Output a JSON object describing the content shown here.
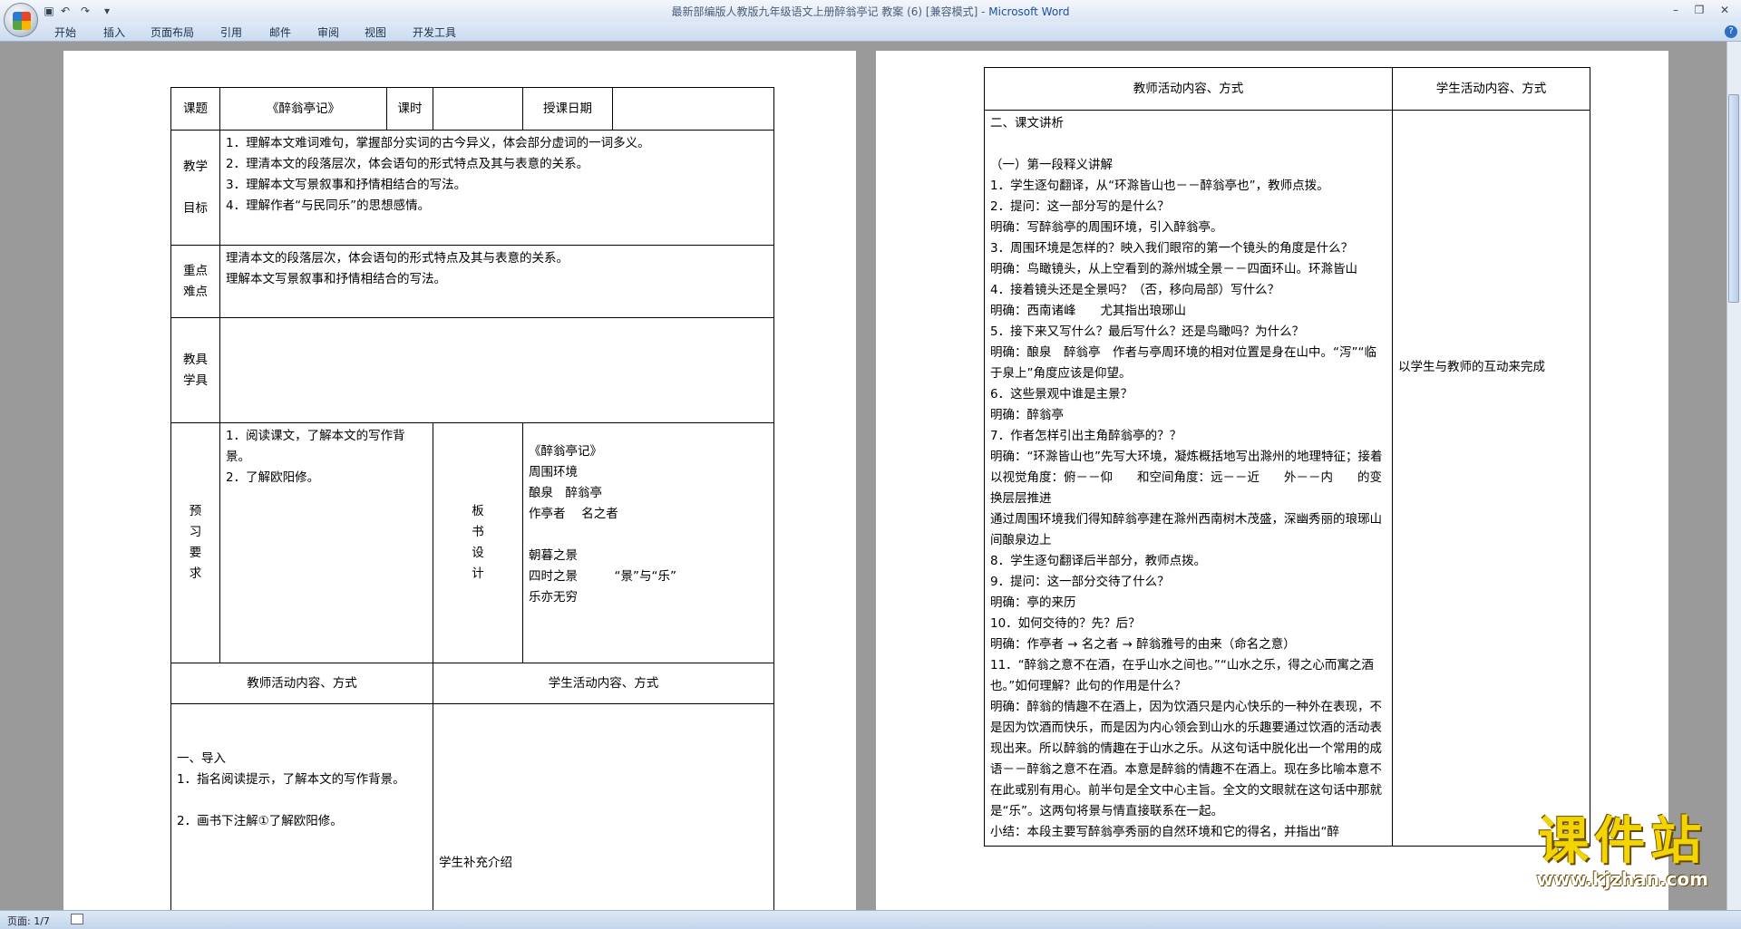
{
  "window": {
    "title": "最新部编版人教版九年级语文上册醉翁亭记 教案 (6) [兼容模式] - ",
    "app": "Microsoft Word"
  },
  "ribbon": {
    "tabs": [
      "开始",
      "插入",
      "页面布局",
      "引用",
      "邮件",
      "审阅",
      "视图",
      "开发工具"
    ]
  },
  "status": {
    "page": "页面: 1/7"
  },
  "watermark": {
    "text": "课件站",
    "url": "www.kjzhan.com"
  },
  "page1": {
    "lesson_label": "课题",
    "lesson_title": "《醉翁亭记》",
    "hours_label": "课时",
    "date_label": "授课日期",
    "goals_label": [
      "教学",
      "目标"
    ],
    "goals": [
      "1．理解本文难词难句，掌握部分实词的古今异义，体会部分虚词的一词多义。",
      "2．理清本文的段落层次，体会语句的形式特点及其与表意的关系。",
      "3．理解本文写景叙事和抒情相结合的写法。",
      "4．理解作者“与民同乐”的思想感情。"
    ],
    "key_label": [
      "重点",
      "难点"
    ],
    "key_points": [
      "理清本文的段落层次，体会语句的形式特点及其与表意的关系。",
      "理解本文写景叙事和抒情相结合的写法。"
    ],
    "tools_label": [
      "教具",
      "学具"
    ],
    "preview_label": [
      "预",
      "习",
      "要",
      "求"
    ],
    "preview": [
      "1．阅读课文，了解本文的写作背景。",
      "2．了解欧阳修。"
    ],
    "board_label": [
      "板",
      "书",
      "设",
      "计"
    ],
    "board": [
      "《醉翁亭记》",
      "周围环境",
      "酿泉　醉翁亭",
      "作亭者　 名之者",
      "",
      "朝暮之景",
      "四时之景　　　“景”与“乐”",
      "乐亦无穷"
    ],
    "teacher_head": "教师活动内容、方式",
    "student_head": "学生活动内容、方式",
    "teacher_items": [
      "",
      "一、导入",
      "1．指名阅读提示，了解本文的写作背景。",
      "",
      "2．画书下注解①了解欧阳修。"
    ],
    "student_note": "学生补充介绍"
  },
  "page2": {
    "teacher_head": "教师活动内容、方式",
    "student_head": "学生活动内容、方式",
    "student_note": "以学生与教师的互动来完成",
    "lines": [
      "二、课文讲析",
      "",
      "（一）第一段释义讲解",
      "1．学生逐句翻译，从“环滁皆山也－－醉翁亭也”，教师点拨。",
      "2．提问：这一部分写的是什么？",
      "明确：写醉翁亭的周围环境，引入醉翁亭。",
      "3．周围环境是怎样的？映入我们眼帘的第一个镜头的角度是什么？",
      "明确：鸟瞰镜头，从上空看到的滁州城全景－－四面环山。环滁皆山",
      "4．接着镜头还是全景吗？（否，移向局部）写什么？",
      "明确：西南诸峰　　尤其指出琅琊山",
      "5．接下来又写什么？最后写什么？还是鸟瞰吗？为什么？",
      "明确：酿泉　醉翁亭　作者与亭周环境的相对位置是身在山中。“泻”“临于泉上”角度应该是仰望。",
      "6．这些景观中谁是主景？",
      "明确：醉翁亭",
      "7．作者怎样引出主角醉翁亭的？？",
      "明确：“环滁皆山也”先写大环境，凝炼概括地写出滁州的地理特征；接着以视觉角度：俯－－仰　　和空间角度：远－－近　　外－－内　　的变换层层推进",
      "通过周围环境我们得知醉翁亭建在滁州西南树木茂盛，深幽秀丽的琅琊山间酿泉边上",
      "8．学生逐句翻译后半部分，教师点拨。",
      "9．提问：这一部分交待了什么？",
      "明确：亭的来历",
      "10．如何交待的？先？后？",
      "明确：作亭者 → 名之者 → 醉翁雅号的由来（命名之意）",
      "11．“醉翁之意不在酒，在乎山水之间也。”“山水之乐，得之心而寓之酒也。”如何理解？此句的作用是什么？",
      "明确：醉翁的情趣不在酒上，因为饮酒只是内心快乐的一种外在表现，不是因为饮酒而快乐，而是因为内心领会到山水的乐趣要通过饮酒的活动表现出来。所以醉翁的情趣在于山水之乐。从这句话中脱化出一个常用的成语－－醉翁之意不在酒。本意是醉翁的情趣不在酒上。现在多比喻本意不在此或别有用心。前半句是全文中心主旨。全文的文眼就在这句话中那就是“乐”。这两句将景与情直接联系在一起。",
      "小结：本段主要写醉翁亭秀丽的自然环境和它的得名，并指出“醉"
    ]
  }
}
